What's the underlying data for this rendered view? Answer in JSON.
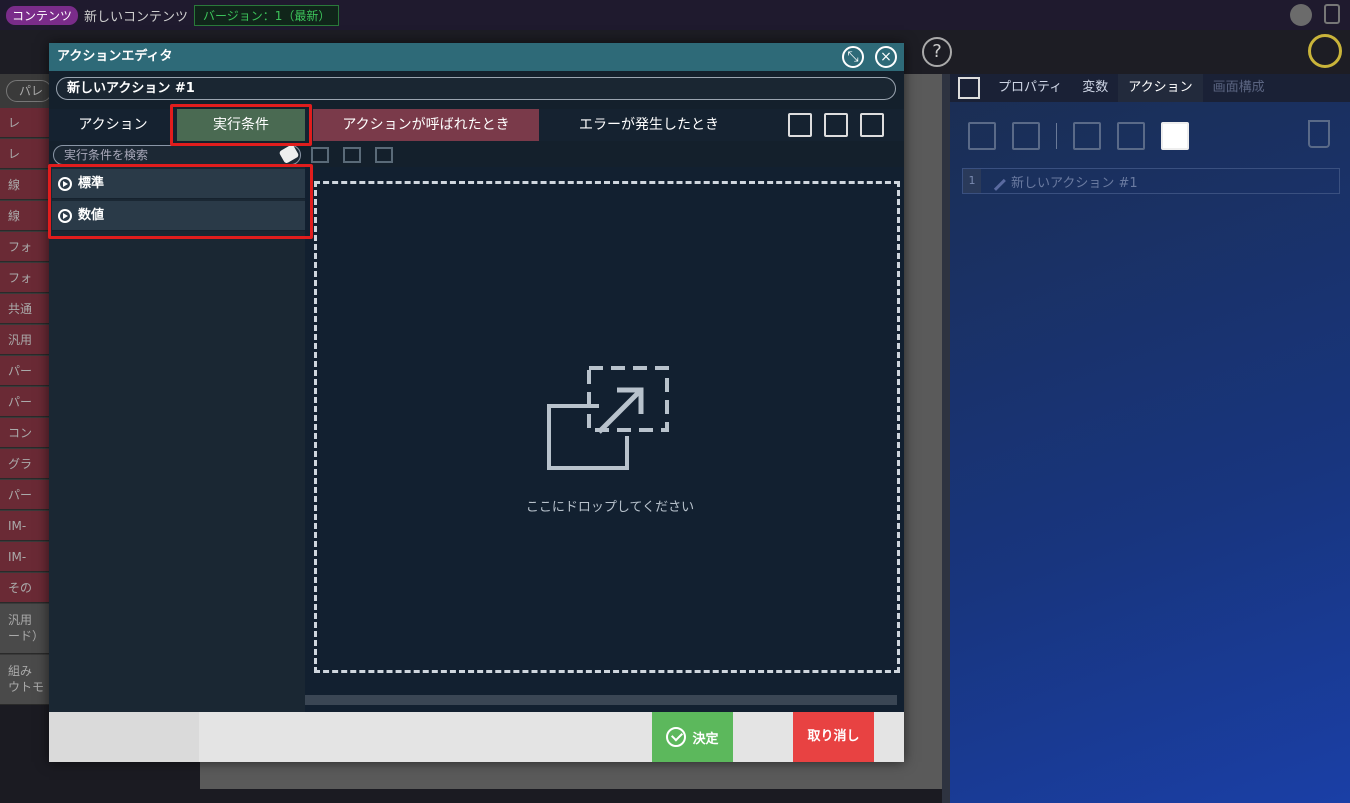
{
  "topbar": {
    "tag": "コンテンツ",
    "content_name": "新しいコンテンツ",
    "version": "バージョン：1（最新）"
  },
  "palette": {
    "search_placeholder": "パレ",
    "items": [
      "レ",
      "レ",
      "線",
      "線",
      "フォ",
      "フォ",
      "共通",
      "汎用",
      "パー",
      "パー",
      "コン",
      "グラ",
      "パー",
      "IM-",
      "IM-",
      "その",
      "汎用\nード）",
      "組み\nウトモ"
    ]
  },
  "right_panel": {
    "tabs": [
      "プロパティ",
      "変数",
      "アクション",
      "画面構成"
    ],
    "active_tab": "アクション",
    "list_item_number": "1",
    "list_item_label": "新しいアクション #1"
  },
  "modal": {
    "title": "アクションエディタ",
    "action_name": "新しいアクション #1",
    "tabs": {
      "action": "アクション",
      "exec_condition": "実行条件",
      "on_called": "アクションが呼ばれたとき",
      "on_error": "エラーが発生したとき"
    },
    "search_placeholder": "実行条件を検索",
    "categories": [
      "標準",
      "数値"
    ],
    "drop_text": "ここにドロップしてください",
    "ok_label": "決定",
    "cancel_label": "取り消し"
  },
  "colors": {
    "highlight": "#e11d1d",
    "ok_button": "#5cb85c",
    "cancel_button": "#e84242",
    "title_bar": "#2e6a78"
  }
}
